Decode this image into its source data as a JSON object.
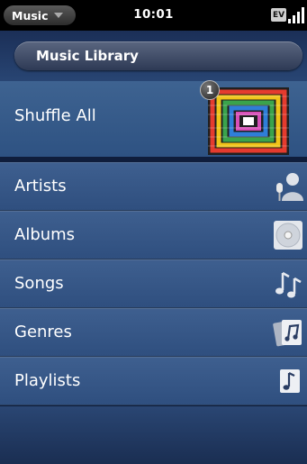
{
  "status_bar": {
    "app_name": "Music",
    "time": "10:01",
    "network": "EV"
  },
  "header": {
    "title": "Music Library"
  },
  "shuffle": {
    "label": "Shuffle All",
    "count": "1"
  },
  "menu_items": [
    {
      "label": "Artists",
      "icon": "artists-icon"
    },
    {
      "label": "Albums",
      "icon": "albums-icon"
    },
    {
      "label": "Songs",
      "icon": "songs-icon"
    },
    {
      "label": "Genres",
      "icon": "genres-icon"
    },
    {
      "label": "Playlists",
      "icon": "playlists-icon"
    }
  ]
}
